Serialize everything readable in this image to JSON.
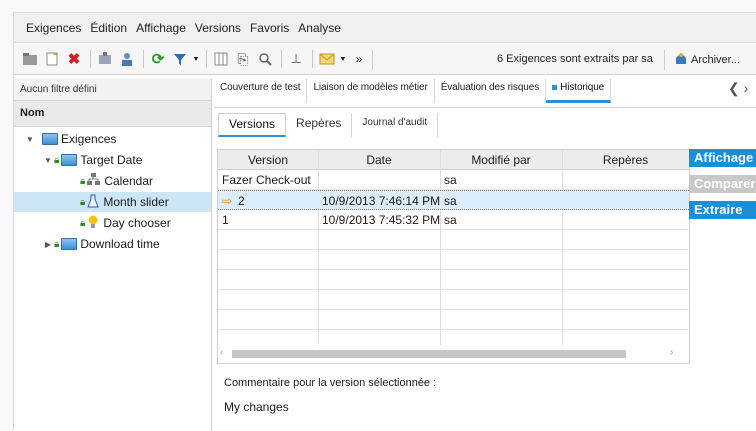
{
  "menu": [
    "Exigences",
    "Édition",
    "Affichage",
    "Versions",
    "Favoris",
    "Analyse"
  ],
  "toolbar": {
    "status_text": "6 Exigences sont extraits par sa",
    "archive_label": "Archiver...",
    "overflow_label": "»"
  },
  "left": {
    "filter_text": "Aucun filtre défini",
    "column_header": "Nom",
    "tree": [
      {
        "label": "Exigences",
        "level": 0,
        "icon": "folder-icon",
        "expanded": true
      },
      {
        "label": "Target Date",
        "level": 1,
        "icon": "folder-icon",
        "expanded": true
      },
      {
        "label": "Calendar",
        "level": 2,
        "icon": "tree-diagram-icon"
      },
      {
        "label": "Month slider",
        "level": 2,
        "icon": "flask-icon",
        "selected": true
      },
      {
        "label": "Day chooser",
        "level": 2,
        "icon": "lightbulb-icon"
      },
      {
        "label": "Download time",
        "level": 1,
        "icon": "folder-icon",
        "expanded": false
      }
    ]
  },
  "tabs_top": [
    "Couverture de test",
    "Liaison de modèles métier",
    "Évaluation des risques",
    "Historique"
  ],
  "tabs_sub": [
    "Versions",
    "Repères",
    "Journal d'audit"
  ],
  "grid": {
    "headers": [
      "Version",
      "Date",
      "Modifié par",
      "Repères"
    ],
    "rows": [
      {
        "version": "Fazer Check-out",
        "date": "",
        "by": "sa",
        "marks": ""
      },
      {
        "version": "2",
        "date": "10/9/2013 7:46:14 PM",
        "by": "sa",
        "marks": "",
        "selected": true
      },
      {
        "version": "1",
        "date": "10/9/2013 7:45:32 PM",
        "by": "sa",
        "marks": ""
      }
    ]
  },
  "side_buttons": {
    "view": "Affichage",
    "compare": "Comparer",
    "extract": "Extraire"
  },
  "comment": {
    "label": "Commentaire pour la version sélectionnée :",
    "value": "My changes"
  },
  "colors": {
    "accent": "#1a8fd8",
    "disabled": "#c8c8c8",
    "selection": "#cce6f7"
  }
}
